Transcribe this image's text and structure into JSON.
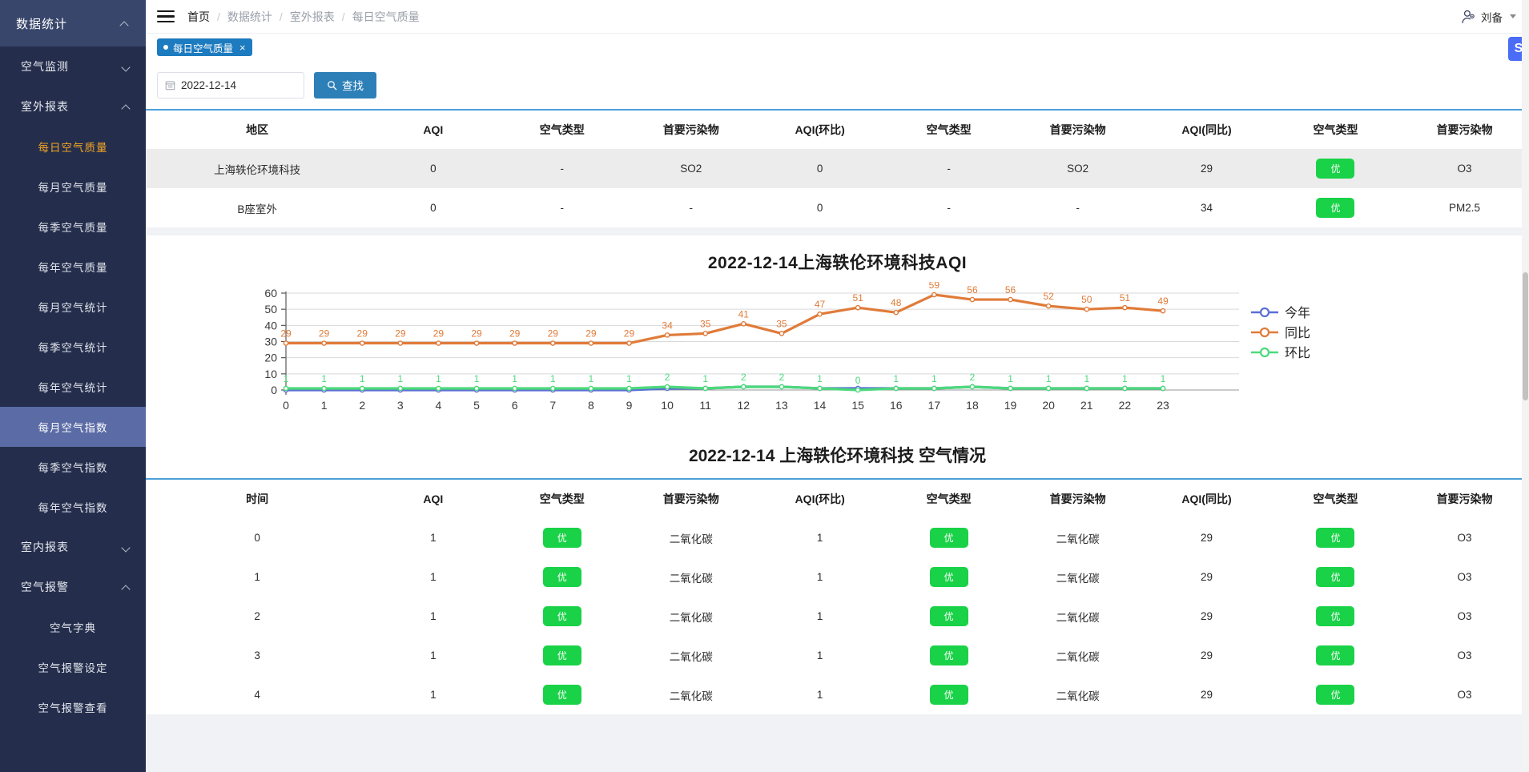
{
  "sidebar": {
    "root": {
      "label": "数据统计",
      "icon": "chevron-up-icon"
    },
    "groups": [
      {
        "label": "空气监测",
        "icon": "chevron-down-icon",
        "expanded": false,
        "items": []
      },
      {
        "label": "室外报表",
        "icon": "chevron-up-icon",
        "expanded": true,
        "items": [
          {
            "label": "每日空气质量",
            "state": "active-orange"
          },
          {
            "label": "每月空气质量",
            "state": ""
          },
          {
            "label": "每季空气质量",
            "state": ""
          },
          {
            "label": "每年空气质量",
            "state": ""
          },
          {
            "label": "每月空气统计",
            "state": ""
          },
          {
            "label": "每季空气统计",
            "state": ""
          },
          {
            "label": "每年空气统计",
            "state": ""
          },
          {
            "label": "每月空气指数",
            "state": "active-blue"
          },
          {
            "label": "每季空气指数",
            "state": ""
          },
          {
            "label": "每年空气指数",
            "state": ""
          }
        ]
      },
      {
        "label": "室内报表",
        "icon": "chevron-down-icon",
        "expanded": false,
        "items": []
      },
      {
        "label": "空气报警",
        "icon": "chevron-up-icon",
        "expanded": true,
        "items": [
          {
            "label": "空气字典",
            "state": ""
          },
          {
            "label": "空气报警设定",
            "state": ""
          },
          {
            "label": "空气报警查看",
            "state": ""
          }
        ]
      }
    ]
  },
  "header": {
    "menu_icon": "hamburger-icon",
    "breadcrumb": [
      "首页",
      "数据统计",
      "室外报表",
      "每日空气质量"
    ],
    "separator": "/",
    "user": {
      "name": "刘备",
      "icon": "user-gear-icon",
      "caret": "chevron-down-icon"
    }
  },
  "tab": {
    "label": "每日空气质量",
    "close": "×"
  },
  "search": {
    "date_value": "2022-12-14",
    "date_icon": "calendar-icon",
    "button_label": "查找",
    "button_icon": "search-icon"
  },
  "fab": {
    "label": "S",
    "name": "quick-action-button"
  },
  "summary_table": {
    "columns": [
      "地区",
      "AQI",
      "空气类型",
      "首要污染物",
      "AQI(环比)",
      "空气类型",
      "首要污染物",
      "AQI(同比)",
      "空气类型",
      "首要污染物"
    ],
    "rows": [
      {
        "cells": [
          "上海轶伦环境科技",
          "0",
          "-",
          "SO2",
          "0",
          "-",
          "SO2",
          "29",
          "优",
          "O3"
        ],
        "badge_cols": [
          8
        ]
      },
      {
        "cells": [
          "B座室外",
          "0",
          "-",
          "-",
          "0",
          "-",
          "-",
          "34",
          "优",
          "PM2.5"
        ],
        "badge_cols": [
          8
        ]
      }
    ]
  },
  "chart_data": {
    "type": "line",
    "title": "2022-12-14上海轶伦环境科技AQI",
    "xlabel": "",
    "ylabel": "",
    "x": [
      0,
      1,
      2,
      3,
      4,
      5,
      6,
      7,
      8,
      9,
      10,
      11,
      12,
      13,
      14,
      15,
      16,
      17,
      18,
      19,
      20,
      21,
      22,
      23
    ],
    "categories": [
      "0",
      "1",
      "2",
      "3",
      "4",
      "5",
      "6",
      "7",
      "8",
      "9",
      "10",
      "11",
      "12",
      "13",
      "14",
      "15",
      "16",
      "17",
      "18",
      "19",
      "20",
      "21",
      "22",
      "23"
    ],
    "ylim": [
      0,
      60
    ],
    "yticks": [
      0,
      10,
      20,
      30,
      40,
      50,
      60
    ],
    "grid": true,
    "legend_position": "right",
    "series": [
      {
        "name": "今年",
        "color": "#5a6fd4",
        "values": [
          0,
          0,
          0,
          0,
          0,
          0,
          0,
          0,
          0,
          0,
          1,
          1,
          2,
          2,
          1,
          1,
          1,
          1,
          2,
          1,
          1,
          1,
          1,
          1
        ],
        "labels": [
          "",
          "",
          "",
          "",
          "",
          "",
          "",
          "",
          "",
          "",
          "",
          "",
          "",
          "",
          "",
          "",
          "",
          "",
          "",
          "",
          "",
          "",
          "",
          ""
        ]
      },
      {
        "name": "同比",
        "color": "#e07b39",
        "values": [
          29,
          29,
          29,
          29,
          29,
          29,
          29,
          29,
          29,
          29,
          34,
          35,
          41,
          35,
          47,
          51,
          48,
          59,
          56,
          56,
          52,
          50,
          51,
          49
        ],
        "labels": [
          "29",
          "29",
          "29",
          "29",
          "29",
          "29",
          "29",
          "29",
          "29",
          "29",
          "34",
          "35",
          "41",
          "35",
          "47",
          "51",
          "48",
          "59",
          "56",
          "56",
          "52",
          "50",
          "51",
          "49"
        ]
      },
      {
        "name": "环比",
        "color": "#4cd97b",
        "values": [
          1,
          1,
          1,
          1,
          1,
          1,
          1,
          1,
          1,
          1,
          2,
          1,
          2,
          2,
          1,
          0,
          1,
          1,
          2,
          1,
          1,
          1,
          1,
          1
        ],
        "labels": [
          "1",
          "1",
          "1",
          "1",
          "1",
          "1",
          "1",
          "1",
          "1",
          "1",
          "2",
          "1",
          "2",
          "2",
          "1",
          "0",
          "1",
          "1",
          "2",
          "1",
          "1",
          "1",
          "1",
          "1"
        ]
      }
    ]
  },
  "detail_title": "2022-12-14 上海轶伦环境科技 空气情况",
  "detail_table": {
    "columns": [
      "时间",
      "AQI",
      "空气类型",
      "首要污染物",
      "AQI(环比)",
      "空气类型",
      "首要污染物",
      "AQI(同比)",
      "空气类型",
      "首要污染物"
    ],
    "rows": [
      {
        "cells": [
          "0",
          "1",
          "优",
          "二氧化碳",
          "1",
          "优",
          "二氧化碳",
          "29",
          "优",
          "O3"
        ],
        "badge_cols": [
          2,
          5,
          8
        ]
      },
      {
        "cells": [
          "1",
          "1",
          "优",
          "二氧化碳",
          "1",
          "优",
          "二氧化碳",
          "29",
          "优",
          "O3"
        ],
        "badge_cols": [
          2,
          5,
          8
        ]
      },
      {
        "cells": [
          "2",
          "1",
          "优",
          "二氧化碳",
          "1",
          "优",
          "二氧化碳",
          "29",
          "优",
          "O3"
        ],
        "badge_cols": [
          2,
          5,
          8
        ]
      },
      {
        "cells": [
          "3",
          "1",
          "优",
          "二氧化碳",
          "1",
          "优",
          "二氧化碳",
          "29",
          "优",
          "O3"
        ],
        "badge_cols": [
          2,
          5,
          8
        ]
      },
      {
        "cells": [
          "4",
          "1",
          "优",
          "二氧化碳",
          "1",
          "优",
          "二氧化碳",
          "29",
          "优",
          "O3"
        ],
        "badge_cols": [
          2,
          5,
          8
        ]
      }
    ]
  },
  "colors": {
    "sidebar_bg": "#242e4c",
    "sidebar_header_bg": "#38466b",
    "sidebar_active_blue": "#5a6ba5",
    "sidebar_active_orange": "#f5a523",
    "accent_blue": "#2d7fb8",
    "tab_blue": "#1d7bbf",
    "badge_green": "#19d247",
    "series_orange": "#e07b39",
    "series_green": "#4cd97b",
    "series_blue": "#5a6fd4",
    "table_top_border": "#4a9fd8"
  }
}
